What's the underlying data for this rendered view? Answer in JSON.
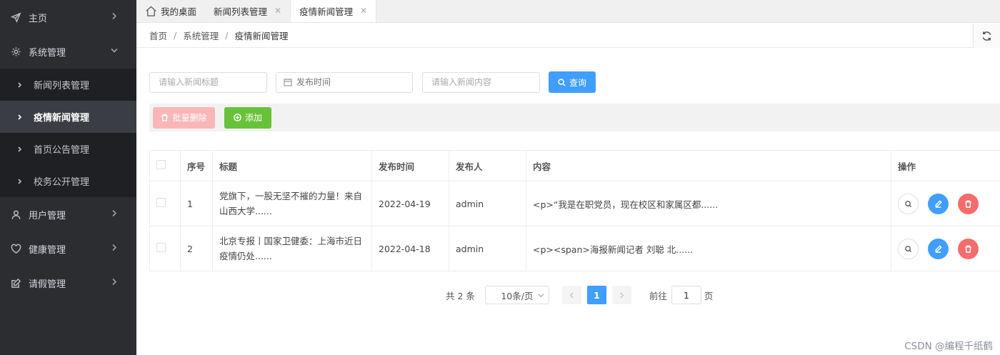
{
  "sidebar": {
    "items": [
      {
        "label": "主页",
        "icon": "send-icon"
      },
      {
        "label": "系统管理",
        "icon": "gear-icon",
        "expanded": true,
        "children": [
          {
            "label": "新闻列表管理"
          },
          {
            "label": "疫情新闻管理",
            "active": true
          },
          {
            "label": "首页公告管理"
          },
          {
            "label": "校务公开管理"
          }
        ]
      },
      {
        "label": "用户管理",
        "icon": "user-icon"
      },
      {
        "label": "健康管理",
        "icon": "heart-icon"
      },
      {
        "label": "请假管理",
        "icon": "edit-icon"
      }
    ]
  },
  "tabs": [
    {
      "label": "我的桌面",
      "icon": "home-icon"
    },
    {
      "label": "新闻列表管理",
      "closable": true
    },
    {
      "label": "疫情新闻管理",
      "closable": true,
      "active": true
    }
  ],
  "breadcrumb": [
    "首页",
    "系统管理",
    "疫情新闻管理"
  ],
  "search": {
    "title_placeholder": "请输入新闻标题",
    "date_placeholder": "发布时间",
    "content_placeholder": "请输入新闻内容",
    "query_label": "查询"
  },
  "actions": {
    "batch_delete_label": "批量删除",
    "add_label": "添加"
  },
  "table": {
    "headers": [
      "序号",
      "标题",
      "发布时间",
      "发布人",
      "内容",
      "操作"
    ],
    "rows": [
      {
        "index": "1",
        "title": "党旗下，一股无坚不摧的力量！来自山西大学......",
        "date": "2022-04-19",
        "author": "admin",
        "content": "<p>“我是在职党员，现在校区和家属区都......"
      },
      {
        "index": "2",
        "title": "北京专报丨国家卫健委：上海市近日疫情仍处......",
        "date": "2022-04-18",
        "author": "admin",
        "content": "<p><span>海报新闻记者 刘聪 北......"
      }
    ]
  },
  "pagination": {
    "total_text": "共 2 条",
    "page_size": "10条/页",
    "current_page": "1",
    "goto_prefix": "前往",
    "goto_value": "1",
    "goto_suffix": "页"
  },
  "watermark": "CSDN @编程千纸鹤",
  "colors": {
    "sidebar_bg": "#2b2d31",
    "primary": "#409eff",
    "success": "#67c23a",
    "danger": "#f56c6c",
    "danger_light": "#fab6b6"
  }
}
